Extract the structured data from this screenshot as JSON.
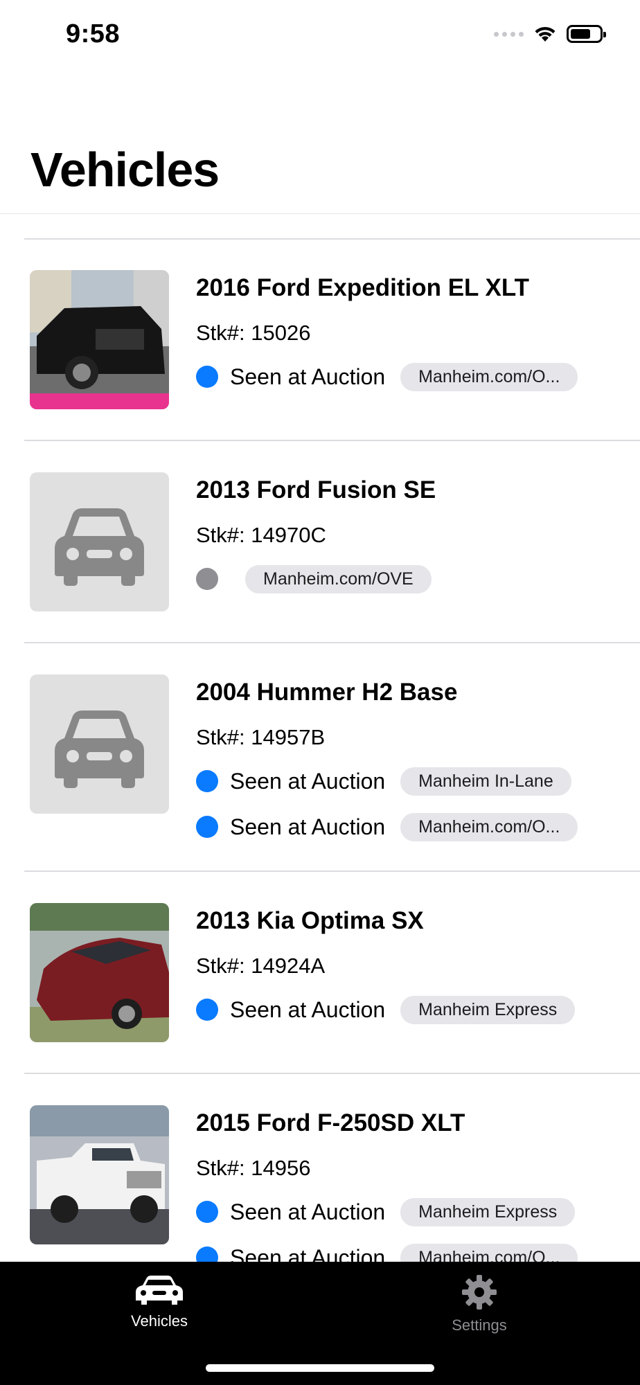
{
  "status_bar": {
    "time": "9:58"
  },
  "page": {
    "title": "Vehicles"
  },
  "vehicles": [
    {
      "title": "2016 Ford Expedition EL XLT",
      "stock": "Stk#: 15026",
      "image": "black-suv-photo",
      "auctions": [
        {
          "status": "Seen at Auction",
          "source": "Manheim.com/O...",
          "dot_color": "#0a7aff"
        }
      ]
    },
    {
      "title": "2013 Ford Fusion SE",
      "stock": "Stk#: 14970C",
      "image": "car-placeholder-icon",
      "auctions": [
        {
          "status": "",
          "source": "Manheim.com/OVE",
          "dot_color": "#8e8e93"
        }
      ]
    },
    {
      "title": "2004 Hummer H2 Base",
      "stock": "Stk#: 14957B",
      "image": "car-placeholder-icon",
      "auctions": [
        {
          "status": "Seen at Auction",
          "source": "Manheim In-Lane",
          "dot_color": "#0a7aff"
        },
        {
          "status": "Seen at Auction",
          "source": "Manheim.com/O...",
          "dot_color": "#0a7aff"
        }
      ]
    },
    {
      "title": "2013 Kia Optima SX",
      "stock": "Stk#: 14924A",
      "image": "red-sedan-photo",
      "auctions": [
        {
          "status": "Seen at Auction",
          "source": "Manheim Express",
          "dot_color": "#0a7aff"
        }
      ]
    },
    {
      "title": "2015 Ford F-250SD XLT",
      "stock": "Stk#: 14956",
      "image": "white-pickup-photo",
      "auctions": [
        {
          "status": "Seen at Auction",
          "source": "Manheim Express",
          "dot_color": "#0a7aff"
        },
        {
          "status": "Seen at Auction",
          "source": "Manheim.com/O...",
          "dot_color": "#0a7aff"
        }
      ]
    }
  ],
  "tab_bar": {
    "tabs": [
      {
        "label": "Vehicles",
        "icon": "car-icon",
        "selected": true
      },
      {
        "label": "Settings",
        "icon": "gear-icon",
        "selected": false
      }
    ],
    "selected_color": "#ffffff",
    "unselected_color": "#8e8e93"
  }
}
